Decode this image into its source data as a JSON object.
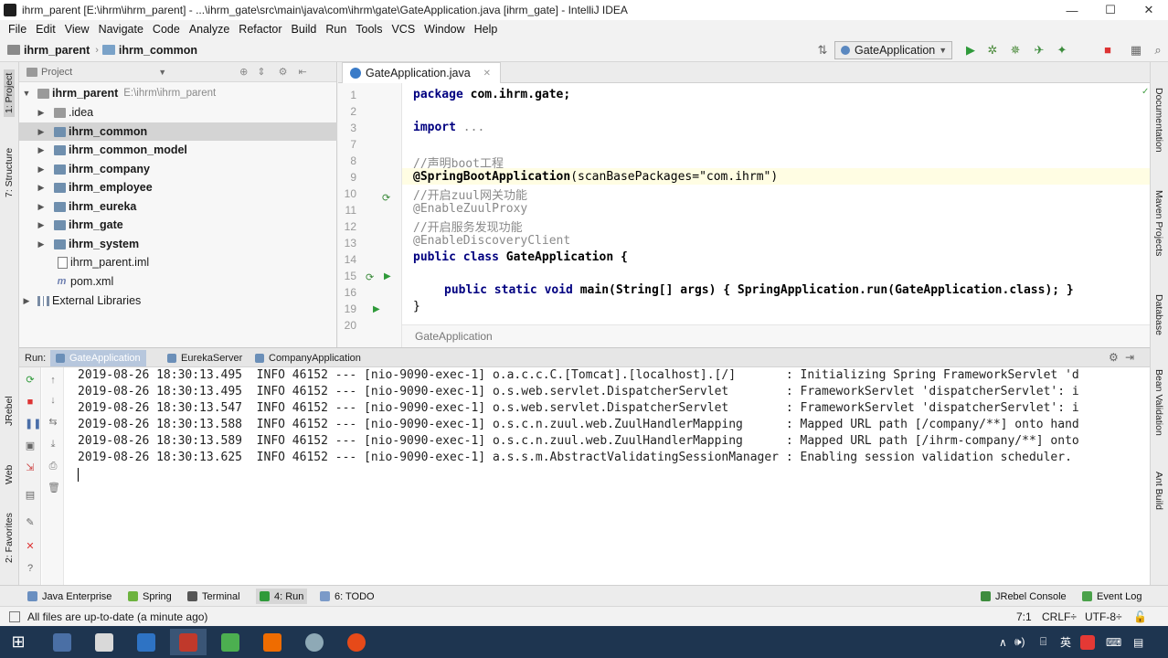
{
  "window": {
    "title": "ihrm_parent [E:\\ihrm\\ihrm_parent] - ...\\ihrm_gate\\src\\main\\java\\com\\ihrm\\gate\\GateApplication.java [ihrm_gate] - IntelliJ IDEA",
    "minimize": "—",
    "maximize": "☐",
    "close": "✕"
  },
  "menu": [
    "File",
    "Edit",
    "View",
    "Navigate",
    "Code",
    "Analyze",
    "Refactor",
    "Build",
    "Run",
    "Tools",
    "VCS",
    "Window",
    "Help"
  ],
  "breadcrumb": {
    "root": "ihrm_parent",
    "child": "ihrm_common"
  },
  "toolbar": {
    "run_config": "GateApplication"
  },
  "project": {
    "header": "Project",
    "root_name": "ihrm_parent",
    "root_path": "E:\\ihrm\\ihrm_parent",
    "items": [
      {
        "label": ".idea",
        "bold": false
      },
      {
        "label": "ihrm_common",
        "bold": true
      },
      {
        "label": "ihrm_common_model",
        "bold": true
      },
      {
        "label": "ihrm_company",
        "bold": true
      },
      {
        "label": "ihrm_employee",
        "bold": true
      },
      {
        "label": "ihrm_eureka",
        "bold": true
      },
      {
        "label": "ihrm_gate",
        "bold": true
      },
      {
        "label": "ihrm_system",
        "bold": true
      },
      {
        "label": "ihrm_parent.iml",
        "bold": false
      },
      {
        "label": "pom.xml",
        "bold": false
      }
    ],
    "external": "External Libraries"
  },
  "editor": {
    "tab": "GateApplication.java",
    "line_numbers": [
      "1",
      "2",
      "3",
      "7",
      "8",
      "9",
      "10",
      "11",
      "12",
      "13",
      "14",
      "15",
      "16",
      "19",
      "20"
    ],
    "code": {
      "l1_kw": "package",
      "l1_rest": " com.ihrm.gate;",
      "l3_kw": "import",
      "l3_rest": " ...",
      "l8": "//声明boot工程",
      "l9_ann": "@SpringBootApplication",
      "l9_mid": "(scanBasePackages=",
      "l9_str": "\"com.ihrm\"",
      "l9_end": ")",
      "l10": "//开启zuul网关功能",
      "l11": "@EnableZuulProxy",
      "l12": "//开启服务发现功能",
      "l13": "@EnableDiscoveryClient",
      "l14_kw": "public class",
      "l14_rest": " GateApplication {",
      "l16_kw": "public static void",
      "l16_rest": " main(String[] args) { SpringApplication.run(GateApplication.class); }",
      "l19": "}"
    },
    "crumb": "GateApplication"
  },
  "run": {
    "label": "Run:",
    "tabs": [
      "GateApplication",
      "EurekaServer",
      "CompanyApplication"
    ],
    "log": [
      "2019-08-26 18:30:13.495  INFO 46152 --- [nio-9090-exec-1] o.a.c.c.C.[Tomcat].[localhost].[/]       : Initializing Spring FrameworkServlet 'd",
      "2019-08-26 18:30:13.495  INFO 46152 --- [nio-9090-exec-1] o.s.web.servlet.DispatcherServlet        : FrameworkServlet 'dispatcherServlet': i",
      "2019-08-26 18:30:13.547  INFO 46152 --- [nio-9090-exec-1] o.s.web.servlet.DispatcherServlet        : FrameworkServlet 'dispatcherServlet': i",
      "2019-08-26 18:30:13.588  INFO 46152 --- [nio-9090-exec-1] o.s.c.n.zuul.web.ZuulHandlerMapping      : Mapped URL path [/company/**] onto hand",
      "2019-08-26 18:30:13.589  INFO 46152 --- [nio-9090-exec-1] o.s.c.n.zuul.web.ZuulHandlerMapping      : Mapped URL path [/ihrm-company/**] onto",
      "2019-08-26 18:30:13.625  INFO 46152 --- [nio-9090-exec-1] a.s.s.m.AbstractValidatingSessionManager : Enabling session validation scheduler."
    ]
  },
  "left_strip": [
    "1: Project",
    "7: Structure",
    "JRebel",
    "Web",
    "2: Favorites"
  ],
  "right_strip": [
    "Documentation",
    "Maven Projects",
    "Database",
    "Bean Validation",
    "Ant Build"
  ],
  "bottom_tabs": [
    "Java Enterprise",
    "Spring",
    "Terminal",
    "4: Run",
    "6: TODO"
  ],
  "bottom_right": [
    "JRebel Console",
    "Event Log"
  ],
  "status": {
    "message": "All files are up-to-date (a minute ago)",
    "position": "7:1",
    "line_sep": "CRLF÷",
    "encoding": "UTF-8÷"
  },
  "tray": {
    "ime": "英",
    "volume": "🕪)"
  }
}
